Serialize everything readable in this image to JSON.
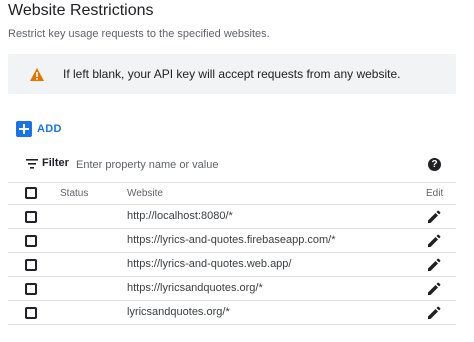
{
  "header": {
    "title": "Website Restrictions",
    "subtitle": "Restrict key usage requests to the specified websites."
  },
  "banner": {
    "icon": "warning-icon",
    "text": "If left blank, your API key will accept requests from any website.",
    "icon_color": "#e37400"
  },
  "add_button": {
    "label": "ADD",
    "icon": "add-box-icon",
    "color": "#1a73e8"
  },
  "filter": {
    "label": "Filter",
    "icon": "filter-list-icon",
    "placeholder": "Enter property name or value",
    "help_icon": "help-icon",
    "help_glyph": "?"
  },
  "table": {
    "columns": {
      "status": "Status",
      "website": "Website",
      "edit": "Edit"
    },
    "rows": [
      {
        "website": "http://localhost:8080/*"
      },
      {
        "website": "https://lyrics-and-quotes.firebaseapp.com/*"
      },
      {
        "website": "https://lyrics-and-quotes.web.app/"
      },
      {
        "website": "https://lyricsandquotes.org/*"
      },
      {
        "website": "lyricsandquotes.org/*"
      }
    ]
  }
}
